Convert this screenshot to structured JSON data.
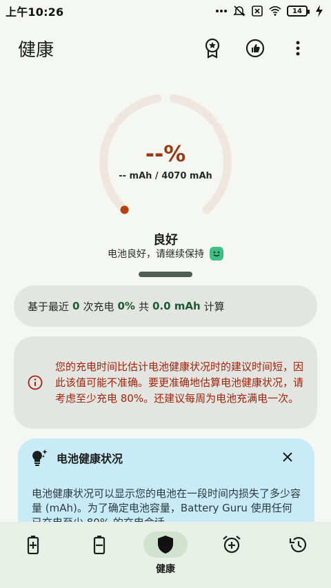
{
  "status_bar": {
    "time": "上午10:26",
    "battery_level": "14",
    "icons": [
      "more-dots-icon",
      "mute-icon",
      "sim-x-icon",
      "wifi-icon",
      "battery-icon",
      "charging-bolt-icon"
    ]
  },
  "app_bar": {
    "title": "健康",
    "actions": [
      "badge-icon",
      "thumb-up-icon",
      "more-vert-icon"
    ]
  },
  "gauge": {
    "percent": "--%",
    "capacity": "-- mAh / 4070 mAh",
    "level_fraction": 0.0
  },
  "health": {
    "label": "良好",
    "description": "电池良好，请继续保持"
  },
  "stats": {
    "prefix": "基于最近",
    "charges": "0",
    "charges_text": "次充电",
    "percent": "0%",
    "total_text": "共",
    "mah": "0.0 mAh",
    "suffix": "计算"
  },
  "warning": {
    "text": "您的充电时间比估计电池健康状况时的建议时间短，因此该值可能不准确。要更准确地估算电池健康状况，请考虑至少充电 80%。还建议每周为电池充满电一次。"
  },
  "info_card": {
    "title": "电池健康状况",
    "body": "电池健康状况可以显示您的电池在一段时间内损失了多少容量 (mAh)。为了确定电池容量，Battery Guru 使用任何已充电至少 80% 的充电会话"
  },
  "bottom_nav": {
    "items": [
      {
        "icon": "battery-charge-icon",
        "label": ""
      },
      {
        "icon": "battery-discharge-icon",
        "label": ""
      },
      {
        "icon": "shield-icon",
        "label": "健康"
      },
      {
        "icon": "alarm-add-icon",
        "label": ""
      },
      {
        "icon": "history-icon",
        "label": ""
      }
    ]
  },
  "colors": {
    "accent_dark": "#9a3a12",
    "gauge_track": "#f0e6e0",
    "gauge_dot": "#b8410f",
    "warning_text": "#a3230e",
    "stat_number": "#1c5b33",
    "info_bg": "#c9eaf7"
  }
}
